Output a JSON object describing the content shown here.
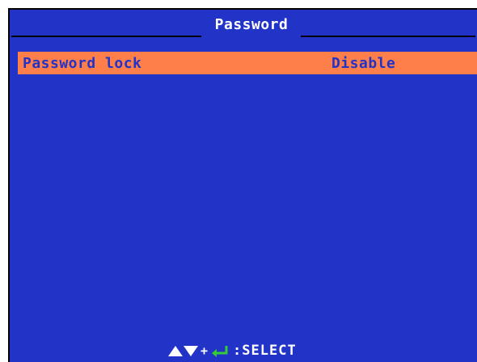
{
  "header": {
    "title": "Password"
  },
  "menu": {
    "items": [
      {
        "label": "Password lock",
        "value": "Disable",
        "selected": true
      }
    ]
  },
  "footer": {
    "plus": "+",
    "hint": ":SELECT",
    "icons": [
      "triangle-up-icon",
      "triangle-down-icon",
      "enter-key-icon"
    ]
  },
  "colors": {
    "background": "#2233c8",
    "highlight": "#ff7f4a",
    "text": "#ffffff",
    "enter_icon": "#33cc33"
  }
}
